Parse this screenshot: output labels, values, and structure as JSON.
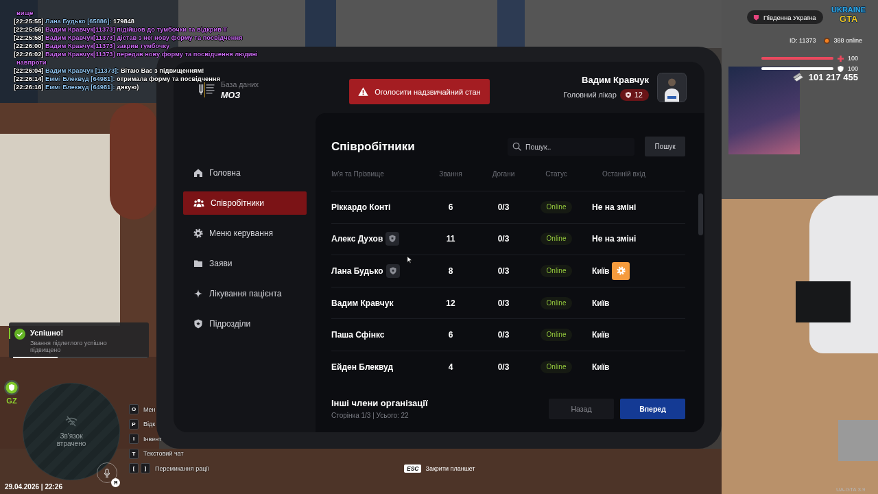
{
  "chat": {
    "lines": [
      {
        "kind": "wrap",
        "text": "вище"
      },
      {
        "kind": "say",
        "time": "[22:25:55]",
        "name": "Лана Будько [65886]:",
        "text": "179848"
      },
      {
        "kind": "action",
        "time": "[22:25:56]",
        "name": "Вадим Кравчук[11373]",
        "text": "підійшов до тумбочки та відкрив її"
      },
      {
        "kind": "action",
        "time": "[22:25:58]",
        "name": "Вадим Кравчук[11373]",
        "text": "дістав з неї нову форму та посвідчення"
      },
      {
        "kind": "action",
        "time": "[22:26:00]",
        "name": "Вадим Кравчук[11373]",
        "text": "закрив тумбочку"
      },
      {
        "kind": "action",
        "time": "[22:26:02]",
        "name": "Вадим Кравчук[11373]",
        "text": "передав нову форму та посвідчення людині"
      },
      {
        "kind": "wrap",
        "text": "навпроти"
      },
      {
        "kind": "say",
        "time": "[22:26:04]",
        "name": "Вадим Кравчук [11373]:",
        "text": "Вітаю Вас з підвищенням!"
      },
      {
        "kind": "say",
        "time": "[22:26:14]",
        "name": "Еммі Блеквуд [64981]:",
        "text": "отримала форму та посвідчення"
      },
      {
        "kind": "say",
        "time": "[22:26:16]",
        "name": "Еммі Блеквуд [64981]:",
        "text": "дякую)"
      }
    ]
  },
  "hud": {
    "region": "Південна Україна",
    "logo": {
      "top": "UKRAINE",
      "bottom": "GTA"
    },
    "player_id": "ID: 11373",
    "online": "388 online",
    "health": {
      "level": 1,
      "value": "100"
    },
    "armor": {
      "level": 1,
      "value": "100"
    },
    "money": "101 217 455"
  },
  "tablet": {
    "header": {
      "logo_caption": "База даних",
      "org": "МОЗ",
      "alert_button": "Оголосити надзвичайний стан",
      "user": {
        "name": "Вадим Кравчук",
        "post": "Головний лікар",
        "rank": "12"
      }
    },
    "sidebar": {
      "items": [
        {
          "label": "Головна",
          "selected": false
        },
        {
          "label": "Співробітники",
          "selected": true
        },
        {
          "label": "Меню керування",
          "selected": false
        },
        {
          "label": "Заяви",
          "selected": false
        },
        {
          "label": "Лікування пацієнта",
          "selected": false
        },
        {
          "label": "Підрозділи",
          "selected": false
        }
      ]
    },
    "staff": {
      "title": "Співробітники",
      "search": {
        "placeholder": "Пошук.."
      },
      "search_button": "Пошук",
      "table": {
        "columns": [
          "Ім'я та Прізвище",
          "Звання",
          "Догани",
          "Статус",
          "Останній вхід"
        ],
        "rows": [
          {
            "name": "Ріккардо Конті",
            "badge": false,
            "rank": "6",
            "warnings": "0/3",
            "status": "Online",
            "last_login": "Не на зміні",
            "hovered": false
          },
          {
            "name": "Алекс Духов",
            "badge": true,
            "rank": "11",
            "warnings": "0/3",
            "status": "Online",
            "last_login": "Не на зміні",
            "hovered": false
          },
          {
            "name": "Лана Будько",
            "badge": true,
            "rank": "8",
            "warnings": "0/3",
            "status": "Online",
            "last_login": "Київ",
            "hovered": true
          },
          {
            "name": "Вадим Кравчук",
            "badge": false,
            "rank": "12",
            "warnings": "0/3",
            "status": "Online",
            "last_login": "Київ",
            "hovered": false
          },
          {
            "name": "Паша Сфінкс",
            "badge": false,
            "rank": "6",
            "warnings": "0/3",
            "status": "Online",
            "last_login": "Київ",
            "hovered": false
          },
          {
            "name": "Ейден Блеквуд",
            "badge": false,
            "rank": "4",
            "warnings": "0/3",
            "status": "Online",
            "last_login": "Київ",
            "hovered": false
          }
        ]
      },
      "footer": {
        "title": "Інші члени організації",
        "page_info": "Сторінка 1/3 | Усього: 22",
        "buttons": [
          {
            "label": "Назад",
            "disabled": true
          },
          {
            "label": "Вперед",
            "disabled": false
          }
        ]
      }
    }
  },
  "notification": {
    "title": "Успішно!",
    "message": "Звання підлеглого успішно підвищено",
    "level": 0.33
  },
  "zone_badge": "GZ",
  "radio": {
    "status": "Зв'язок втрачено",
    "mic_badge": "Я"
  },
  "key_hints": [
    {
      "keys": [
        "O"
      ],
      "label": "Мен"
    },
    {
      "keys": [
        "P"
      ],
      "label": "Відк"
    },
    {
      "keys": [
        "I"
      ],
      "label": "Інвент"
    },
    {
      "keys": [
        "T"
      ],
      "label": "Текстовий чат"
    },
    {
      "keys": [
        "[",
        "]"
      ],
      "label": "Перемикання рації"
    }
  ],
  "datetime": "29.04.2026 | 22:26",
  "esc_hint": {
    "key": "ESC",
    "label": "Закрити планшет"
  },
  "version": "UA-GTA 3.9"
}
